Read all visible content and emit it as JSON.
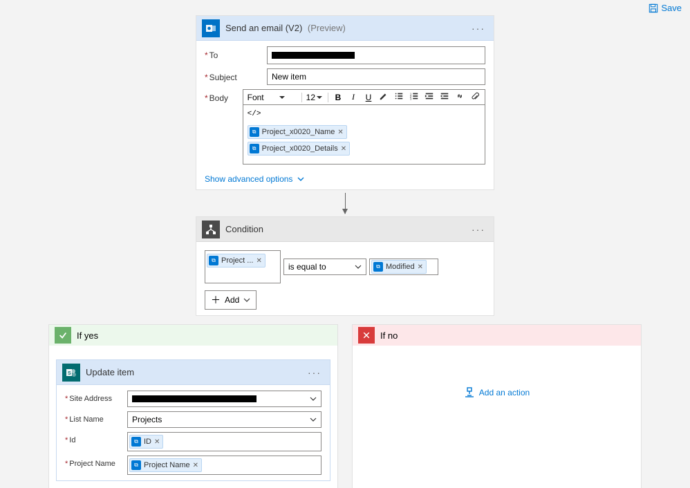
{
  "toolbar": {
    "save": "Save"
  },
  "email": {
    "title": "Send an email (V2)",
    "preview": "(Preview)",
    "labels": {
      "to": "To",
      "subject": "Subject",
      "body": "Body"
    },
    "subject_value": "New item",
    "rte": {
      "font": "Font",
      "size": "12"
    },
    "tokens": {
      "name": "Project_x0020_Name",
      "details": "Project_x0020_Details"
    },
    "adv": "Show advanced options"
  },
  "condition": {
    "title": "Condition",
    "left": "Project ...",
    "operator": "is equal to",
    "right": "Modified",
    "add": "Add"
  },
  "branch": {
    "yes": "If yes",
    "no": "If no",
    "add_action": "Add an action"
  },
  "update": {
    "title": "Update item",
    "labels": {
      "site": "Site Address",
      "list": "List Name",
      "id": "Id",
      "projname": "Project Name"
    },
    "list_value": "Projects",
    "id_token": "ID",
    "projname_token": "Project Name"
  }
}
